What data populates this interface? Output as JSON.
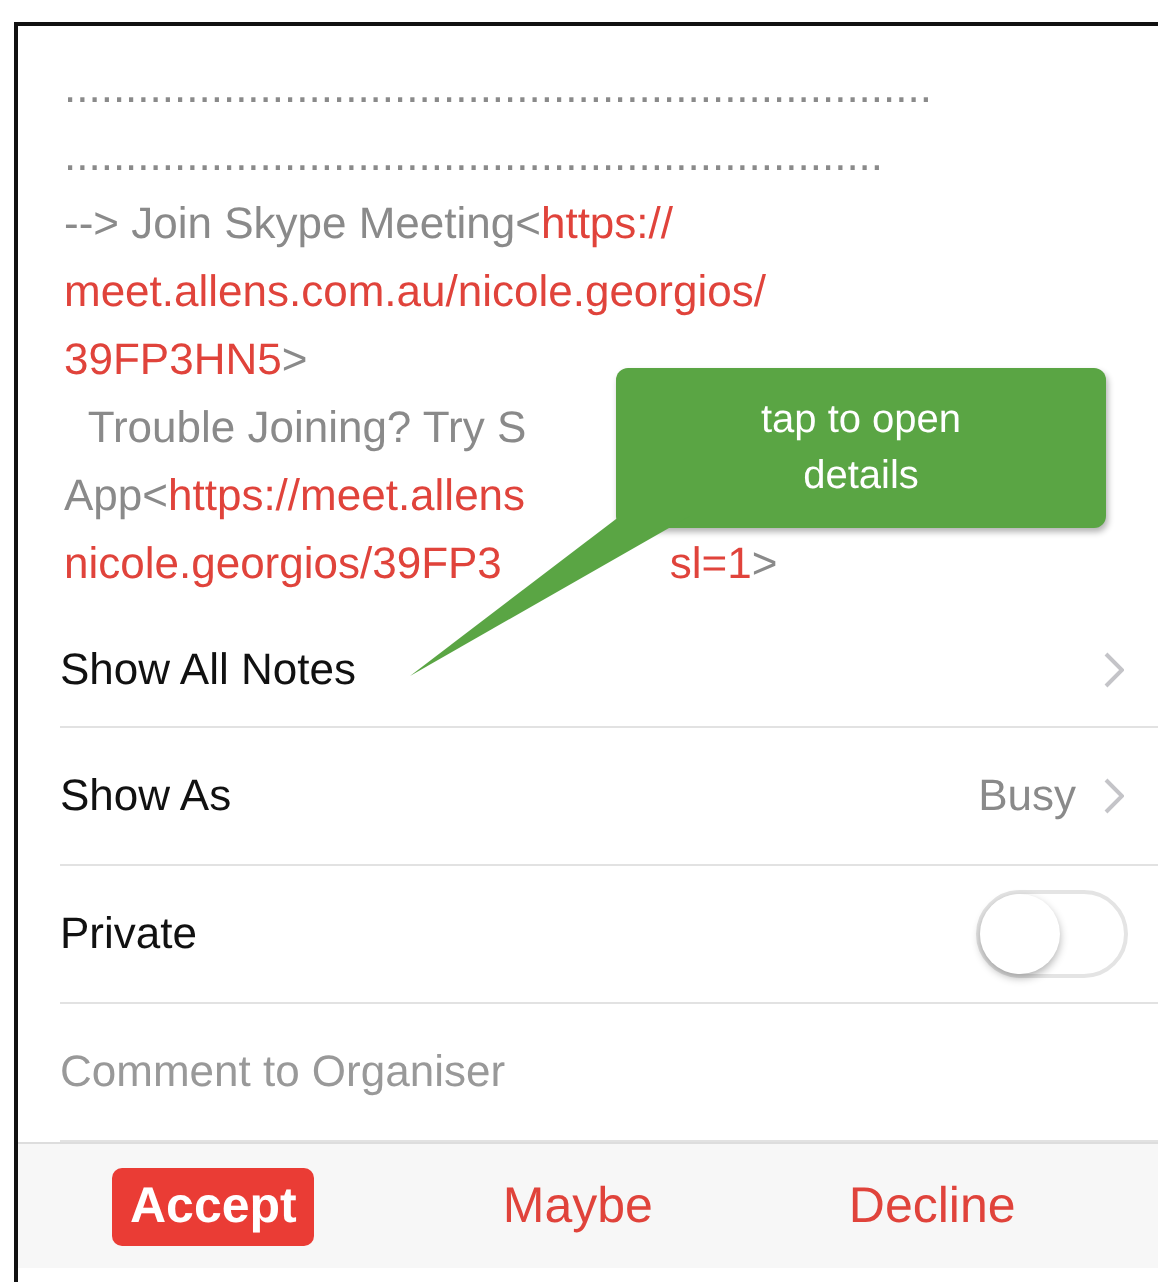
{
  "notes": {
    "lines": [
      [
        {
          "kind": "plain",
          "text": "......................................................................."
        }
      ],
      [
        {
          "kind": "plain",
          "text": "..................................................................."
        }
      ],
      [
        {
          "kind": "plain",
          "text": "--> Join Skype Meeting<"
        },
        {
          "kind": "link",
          "text": "https://"
        }
      ],
      [
        {
          "kind": "link",
          "text": "meet.allens.com.au/nicole.georgios/"
        }
      ],
      [
        {
          "kind": "link",
          "text": "39FP3HN5"
        },
        {
          "kind": "plain",
          "text": ">"
        }
      ],
      [
        {
          "kind": "plain",
          "text": "  Trouble Joining? Try S"
        }
      ],
      [
        {
          "kind": "plain",
          "text": "App<"
        },
        {
          "kind": "link",
          "text": "https://meet.allens"
        }
      ],
      [
        {
          "kind": "link",
          "text": "nicole.georgios/39FP3"
        },
        {
          "kind": "link",
          "text": "sl=1",
          "gap_before": true
        },
        {
          "kind": "plain",
          "text": ">"
        }
      ]
    ]
  },
  "callout": {
    "text": "tap to open details"
  },
  "rows": [
    {
      "kind": "link",
      "label": "Show All Notes"
    },
    {
      "kind": "value",
      "label": "Show As",
      "value": "Busy"
    },
    {
      "kind": "switch",
      "label": "Private",
      "on": false
    },
    {
      "kind": "field",
      "placeholder": "Comment to Organiser"
    }
  ],
  "actions": [
    {
      "label": "Accept",
      "selected": true
    },
    {
      "label": "Maybe",
      "selected": false
    },
    {
      "label": "Decline",
      "selected": false
    }
  ]
}
